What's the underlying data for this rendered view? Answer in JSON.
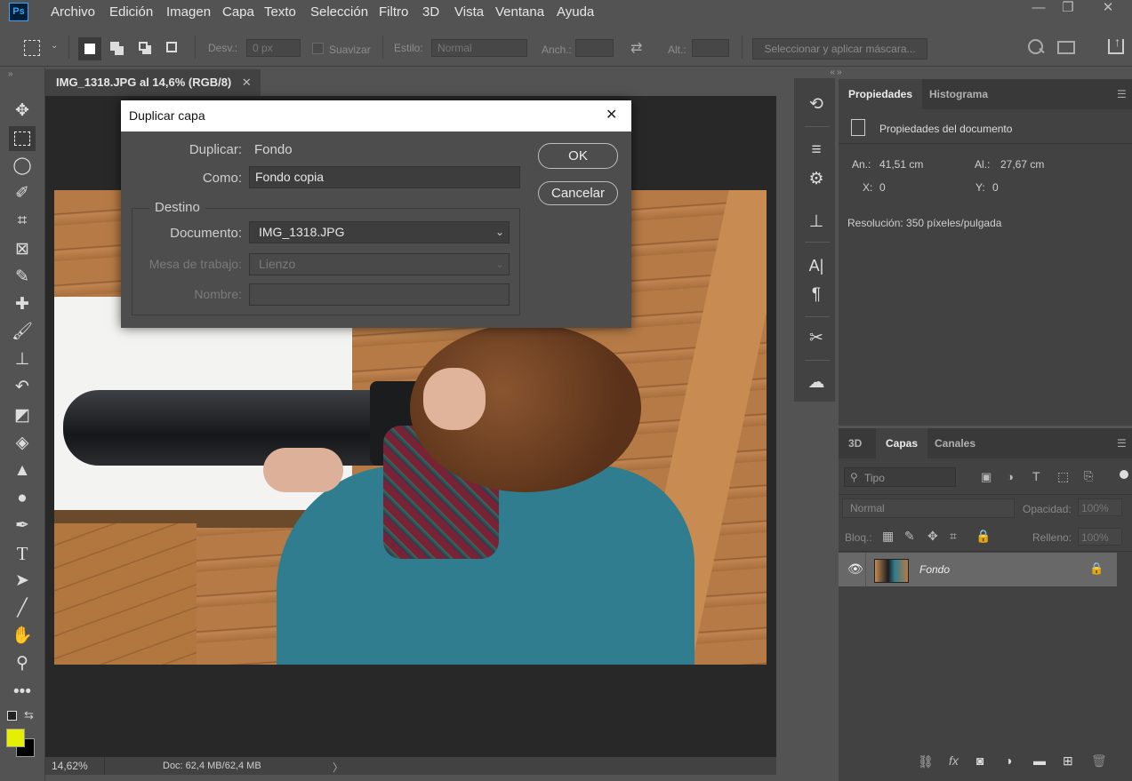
{
  "app": {
    "logo_text": "Ps"
  },
  "menu": [
    "Archivo",
    "Edición",
    "Imagen",
    "Capa",
    "Texto",
    "Selección",
    "Filtro",
    "3D",
    "Vista",
    "Ventana",
    "Ayuda"
  ],
  "window_controls": {
    "minimize": "—",
    "restore": "❐",
    "close": "✕"
  },
  "options": {
    "feather_label": "Desv.:",
    "feather_value": "0 px",
    "antialias_label": "Suavizar",
    "style_label": "Estilo:",
    "style_value": "Normal",
    "width_label": "Anch.:",
    "height_label": "Alt.:",
    "mask_button": "Seleccionar y aplicar máscara..."
  },
  "document": {
    "tab_title": "IMG_1318.JPG al 14,6% (RGB/8)",
    "zoom": "14,62%",
    "doc_size": "Doc: 62,4 MB/62,4 MB",
    "status_arrow": "〉"
  },
  "properties_panel": {
    "tabs": [
      "Propiedades",
      "Histograma"
    ],
    "section_title": "Propiedades del documento",
    "width_label": "An.:",
    "width_value": "41,51 cm",
    "height_label": "Al.:",
    "height_value": "27,67 cm",
    "x_label": "X:",
    "x_value": "0",
    "y_label": "Y:",
    "y_value": "0",
    "resolution": "Resolución: 350 píxeles/pulgada"
  },
  "layers_panel": {
    "tabs": [
      "3D",
      "Capas",
      "Canales"
    ],
    "active_tab": "Capas",
    "filter_placeholder": "Tipo",
    "blend_mode": "Normal",
    "opacity_label": "Opacidad:",
    "opacity_value": "100%",
    "lock_label": "Bloq.:",
    "fill_label": "Relleno:",
    "fill_value": "100%",
    "layers": [
      {
        "name": "Fondo",
        "locked": true,
        "visible": true
      }
    ]
  },
  "dialog": {
    "title": "Duplicar capa",
    "duplicate_label": "Duplicar:",
    "duplicate_value": "Fondo",
    "as_label": "Como:",
    "as_value": "Fondo copia",
    "destination_group": "Destino",
    "document_label": "Documento:",
    "document_value": "IMG_1318.JPG",
    "artboard_label": "Mesa de trabajo:",
    "artboard_value": "Lienzo",
    "name_label": "Nombre:",
    "name_value": "",
    "ok_button": "OK",
    "cancel_button": "Cancelar",
    "close_glyph": "✕"
  },
  "colors": {
    "foreground": "#e5f000",
    "background": "#000000",
    "accent": "#31a8ff"
  }
}
